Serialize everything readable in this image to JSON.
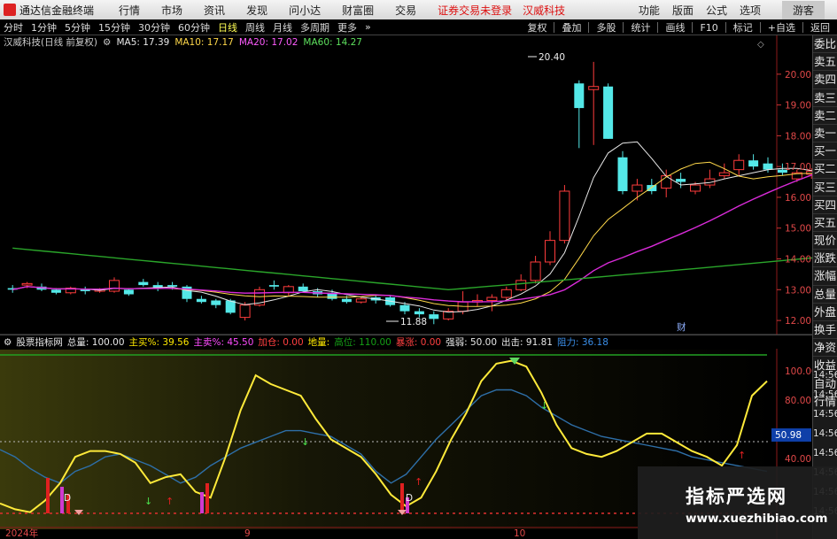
{
  "menubar": {
    "app_title": "通达信金融终端",
    "items": [
      "行情",
      "市场",
      "资讯",
      "发现",
      "问小达",
      "财富圈",
      "交易"
    ],
    "warning": "证券交易未登录",
    "stock_name": "汉威科技",
    "right_items": [
      "功能",
      "版面",
      "公式",
      "选项"
    ],
    "guest": "游客"
  },
  "periodbar": {
    "items": [
      "分时",
      "1分钟",
      "5分钟",
      "15分钟",
      "30分钟",
      "60分钟",
      "日线",
      "周线",
      "月线",
      "多周期",
      "更多"
    ],
    "active_index": 6,
    "right_items": [
      "复权",
      "叠加",
      "多股",
      "统计",
      "画线",
      "F10",
      "标记",
      "+自选",
      "返回"
    ]
  },
  "infobar": {
    "title": "汉威科技(日线 前复权)",
    "ma5": "MA5: 17.39",
    "ma10": "MA10: 17.17",
    "ma20": "MA20: 17.02",
    "ma60": "MA60: 14.27"
  },
  "price_axis": [
    "20.00",
    "19.00",
    "18.00",
    "17.00",
    "16.00",
    "15.00",
    "14.00",
    "13.00",
    "12.00"
  ],
  "annotations": {
    "high": "20.40",
    "low": "11.88",
    "cai": "财"
  },
  "right_panel": [
    "委比",
    "卖五",
    "卖四",
    "卖三",
    "卖二",
    "卖一",
    "买一",
    "买二",
    "买三",
    "买四",
    "买五",
    "现价",
    "涨跌",
    "涨幅",
    "总量",
    "外盘",
    "换手",
    "净资",
    "收益",
    "自动",
    "行情"
  ],
  "indicator_bar": {
    "name": "股票指标网",
    "total": "总量: 100.00",
    "main_buy": "主买%: 39.56",
    "main_sell": "主卖%: 45.50",
    "add_position": "加仓: 0.00",
    "ground": "地量: ",
    "high_pos": "高位: 110.00",
    "surge": "暴涨: 0.00",
    "strong": "强弱: 50.00",
    "out": "出击: 91.81",
    "resist": "阻力: 36.18"
  },
  "indicator_axis": [
    "100.00",
    "80.00",
    "40.00"
  ],
  "indicator_badge": "50.98",
  "time_column": [
    "14:56",
    "14:56",
    "14:56",
    "14:56",
    "14:56",
    "14:56",
    "14:56",
    "14:56"
  ],
  "x_axis": [
    "2024年",
    "9",
    "10"
  ],
  "watermark": {
    "title": "指标严选网",
    "url": "www.xuezhibiao.com"
  },
  "colors": {
    "up": "#ff3c3c",
    "down": "#54e8e8",
    "ma5": "#e8e8e8",
    "ma10": "#ffd84a",
    "ma20": "#d92bd9",
    "ma60": "#2aa52a",
    "ind_yellow": "#ffea3a",
    "ind_blue": "#2e6fa8"
  },
  "chart_data": {
    "type": "candlestick",
    "title": "汉威科技(日线 前复权)",
    "ylim": [
      11.6,
      20.8
    ],
    "candles": [
      [
        13.05,
        13.15,
        12.9,
        13.0
      ],
      [
        13.15,
        13.25,
        13.05,
        13.2
      ],
      [
        13.1,
        13.2,
        12.95,
        13.0
      ],
      [
        13.0,
        13.05,
        12.85,
        12.9
      ],
      [
        12.9,
        13.1,
        12.85,
        13.05
      ],
      [
        13.0,
        13.1,
        12.85,
        12.95
      ],
      [
        12.95,
        13.05,
        12.9,
        13.0
      ],
      [
        12.95,
        13.4,
        12.9,
        13.3
      ],
      [
        13.0,
        13.05,
        12.8,
        12.85
      ],
      [
        13.25,
        13.35,
        13.1,
        13.15
      ],
      [
        13.15,
        13.25,
        12.95,
        13.05
      ],
      [
        13.15,
        13.25,
        13.0,
        13.1
      ],
      [
        13.1,
        13.15,
        12.6,
        12.7
      ],
      [
        12.7,
        12.8,
        12.55,
        12.6
      ],
      [
        12.65,
        12.7,
        12.4,
        12.5
      ],
      [
        12.65,
        12.7,
        12.2,
        12.25
      ],
      [
        12.1,
        12.6,
        12.0,
        12.5
      ],
      [
        12.5,
        13.1,
        12.45,
        13.0
      ],
      [
        13.15,
        13.3,
        13.0,
        13.1
      ],
      [
        12.9,
        13.15,
        12.8,
        13.1
      ],
      [
        13.1,
        13.2,
        12.9,
        12.95
      ],
      [
        12.95,
        13.05,
        12.75,
        12.85
      ],
      [
        12.9,
        13.0,
        12.65,
        12.7
      ],
      [
        12.7,
        12.8,
        12.55,
        12.6
      ],
      [
        12.6,
        12.75,
        12.55,
        12.7
      ],
      [
        12.75,
        12.85,
        12.55,
        12.65
      ],
      [
        12.75,
        12.8,
        12.45,
        12.5
      ],
      [
        12.5,
        12.6,
        12.2,
        12.3
      ],
      [
        12.3,
        12.4,
        12.1,
        12.2
      ],
      [
        12.2,
        12.3,
        11.88,
        12.05
      ],
      [
        12.05,
        12.4,
        12.0,
        12.3
      ],
      [
        12.3,
        12.95,
        12.2,
        12.6
      ],
      [
        12.6,
        12.85,
        12.45,
        12.65
      ],
      [
        12.65,
        12.85,
        12.3,
        12.75
      ],
      [
        12.75,
        13.1,
        12.65,
        13.0
      ],
      [
        13.0,
        13.5,
        12.95,
        13.3
      ],
      [
        13.3,
        14.1,
        13.2,
        13.9
      ],
      [
        13.9,
        14.9,
        13.8,
        14.6
      ],
      [
        14.6,
        16.4,
        14.5,
        16.2
      ],
      [
        19.7,
        19.8,
        17.6,
        18.9
      ],
      [
        19.5,
        20.4,
        17.7,
        19.6
      ],
      [
        19.6,
        19.7,
        17.9,
        17.9
      ],
      [
        17.3,
        17.5,
        16.1,
        16.2
      ],
      [
        16.2,
        16.6,
        15.9,
        16.4
      ],
      [
        16.4,
        16.6,
        16.1,
        16.2
      ],
      [
        16.3,
        16.9,
        16.0,
        16.7
      ],
      [
        16.6,
        16.8,
        16.3,
        16.5
      ],
      [
        16.2,
        16.5,
        16.1,
        16.4
      ],
      [
        16.4,
        16.9,
        16.3,
        16.6
      ],
      [
        16.7,
        17.1,
        16.6,
        16.8
      ],
      [
        16.9,
        17.4,
        16.7,
        17.2
      ],
      [
        17.2,
        17.4,
        16.9,
        17.0
      ],
      [
        17.1,
        17.3,
        16.8,
        16.9
      ],
      [
        16.9,
        17.1,
        16.7,
        16.8
      ],
      [
        16.6,
        16.9,
        16.5,
        16.8
      ],
      [
        16.75,
        16.95,
        16.6,
        16.85
      ],
      [
        16.8,
        17.0,
        16.7,
        16.85
      ],
      [
        16.9,
        17.2,
        16.8,
        17.1
      ],
      [
        17.2,
        17.8,
        17.1,
        17.8
      ],
      [
        17.8,
        17.9,
        17.5,
        17.6
      ],
      [
        17.6,
        18.0,
        17.4,
        17.5
      ]
    ],
    "ma60_y": [
      14.35,
      13.0
    ]
  }
}
